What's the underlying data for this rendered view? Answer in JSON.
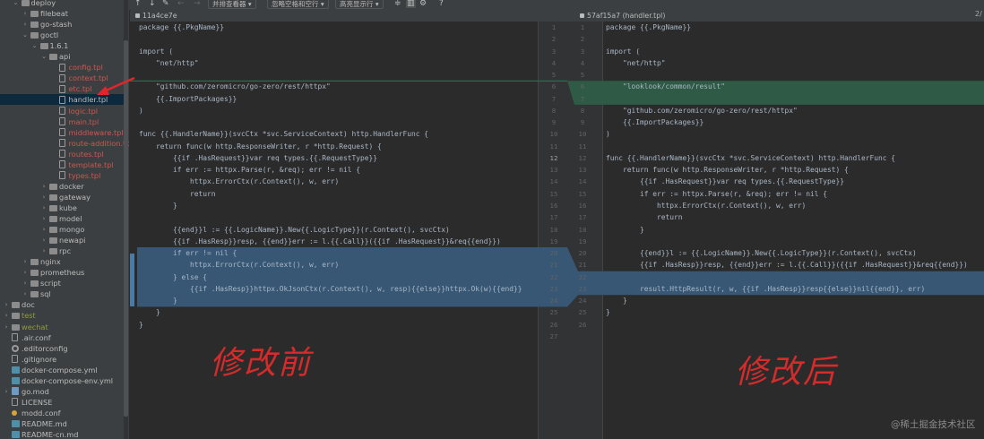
{
  "sidebar": {
    "items": [
      {
        "label": "deploy",
        "level": 1,
        "type": "folder",
        "open": true
      },
      {
        "label": "filebeat",
        "level": 2,
        "type": "folder",
        "open": false
      },
      {
        "label": "go-stash",
        "level": 2,
        "type": "folder",
        "open": false
      },
      {
        "label": "goctl",
        "level": 2,
        "type": "folder",
        "open": true
      },
      {
        "label": "1.6.1",
        "level": 3,
        "type": "folder",
        "open": true
      },
      {
        "label": "api",
        "level": 4,
        "type": "folder",
        "open": true
      },
      {
        "label": "config.tpl",
        "level": 5,
        "type": "file",
        "status": "red"
      },
      {
        "label": "context.tpl",
        "level": 5,
        "type": "file",
        "status": "red"
      },
      {
        "label": "etc.tpl",
        "level": 5,
        "type": "file",
        "status": "red"
      },
      {
        "label": "handler.tpl",
        "level": 5,
        "type": "file",
        "status": "selected"
      },
      {
        "label": "logic.tpl",
        "level": 5,
        "type": "file",
        "status": "red"
      },
      {
        "label": "main.tpl",
        "level": 5,
        "type": "file",
        "status": "red"
      },
      {
        "label": "middleware.tpl",
        "level": 5,
        "type": "file",
        "status": "red"
      },
      {
        "label": "route-addition.tpl",
        "level": 5,
        "type": "file",
        "status": "red"
      },
      {
        "label": "routes.tpl",
        "level": 5,
        "type": "file",
        "status": "red"
      },
      {
        "label": "template.tpl",
        "level": 5,
        "type": "file",
        "status": "red"
      },
      {
        "label": "types.tpl",
        "level": 5,
        "type": "file",
        "status": "red"
      },
      {
        "label": "docker",
        "level": 4,
        "type": "folder",
        "open": false
      },
      {
        "label": "gateway",
        "level": 4,
        "type": "folder",
        "open": false
      },
      {
        "label": "kube",
        "level": 4,
        "type": "folder",
        "open": false
      },
      {
        "label": "model",
        "level": 4,
        "type": "folder",
        "open": false
      },
      {
        "label": "mongo",
        "level": 4,
        "type": "folder",
        "open": false
      },
      {
        "label": "newapi",
        "level": 4,
        "type": "folder",
        "open": false
      },
      {
        "label": "rpc",
        "level": 4,
        "type": "folder",
        "open": false
      },
      {
        "label": "nginx",
        "level": 2,
        "type": "folder",
        "open": false
      },
      {
        "label": "prometheus",
        "level": 2,
        "type": "folder",
        "open": false
      },
      {
        "label": "script",
        "level": 2,
        "type": "folder",
        "open": false
      },
      {
        "label": "sql",
        "level": 2,
        "type": "folder",
        "open": false
      },
      {
        "label": "doc",
        "level": 0,
        "type": "folder",
        "open": false
      },
      {
        "label": "test",
        "level": 0,
        "type": "folder",
        "open": false,
        "status": "olive"
      },
      {
        "label": "wechat",
        "level": 0,
        "type": "folder",
        "open": false,
        "status": "olive"
      },
      {
        "label": ".air.conf",
        "level": 0,
        "type": "file"
      },
      {
        "label": ".editorconfig",
        "level": 0,
        "type": "cfg"
      },
      {
        "label": ".gitignore",
        "level": 0,
        "type": "file"
      },
      {
        "label": "docker-compose.yml",
        "level": 0,
        "type": "yml"
      },
      {
        "label": "docker-compose-env.yml",
        "level": 0,
        "type": "yml"
      },
      {
        "label": "go.mod",
        "level": 0,
        "type": "mod",
        "expandable": true
      },
      {
        "label": "LICENSE",
        "level": 0,
        "type": "file"
      },
      {
        "label": "modd.conf",
        "level": 0,
        "type": "modd"
      },
      {
        "label": "README.md",
        "level": 0,
        "type": "yml"
      },
      {
        "label": "README-cn.md",
        "level": 0,
        "type": "yml"
      }
    ]
  },
  "toolbar": {
    "icons": [
      "arrow-up-icon",
      "arrow-down-icon",
      "edit-icon",
      "back-icon",
      "forward-icon"
    ],
    "viewer": "并排查看器 ▾",
    "whitespace": "忽略空格和空行 ▾",
    "highlight": "高亮显示行 ▾",
    "diff_count": "2/"
  },
  "left": {
    "revision": "11a4ce7e",
    "lines": [
      "package {{.PkgName}}",
      "",
      "import (",
      "    \"net/http\"",
      "",
      "    \"github.com/zeromicro/go-zero/rest/httpx\"",
      "    {{.ImportPackages}}",
      ")",
      "",
      "func {{.HandlerName}}(svcCtx *svc.ServiceContext) http.HandlerFunc {",
      "    return func(w http.ResponseWriter, r *http.Request) {",
      "        {{if .HasRequest}}var req types.{{.RequestType}}",
      "        if err := httpx.Parse(r, &req); err != nil {",
      "            httpx.ErrorCtx(r.Context(), w, err)",
      "            return",
      "        }",
      "",
      "        {{end}}l := {{.LogicName}}.New{{.LogicType}}(r.Context(), svcCtx)",
      "        {{if .HasResp}}resp, {{end}}err := l.{{.Call}}({{if .HasRequest}}&req{{end}})",
      "        if err != nil {",
      "            httpx.ErrorCtx(r.Context(), w, err)",
      "        } else {",
      "            {{if .HasResp}}httpx.OkJsonCtx(r.Context(), w, resp){{else}}httpx.Ok(w){{end}}",
      "        }",
      "    }",
      "}"
    ]
  },
  "right": {
    "revision": "57af15a7 (handler.tpl)",
    "lines": [
      "package {{.PkgName}}",
      "",
      "import (",
      "    \"net/http\"",
      "",
      "    \"looklook/common/result\"",
      "",
      "    \"github.com/zeromicro/go-zero/rest/httpx\"",
      "    {{.ImportPackages}}",
      ")",
      "",
      "func {{.HandlerName}}(svcCtx *svc.ServiceContext) http.HandlerFunc {",
      "    return func(w http.ResponseWriter, r *http.Request) {",
      "        {{if .HasRequest}}var req types.{{.RequestType}}",
      "        if err := httpx.Parse(r, &req); err != nil {",
      "            httpx.ErrorCtx(r.Context(), w, err)",
      "            return",
      "        }",
      "",
      "        {{end}}l := {{.LogicName}}.New{{.LogicType}}(r.Context(), svcCtx)",
      "        {{if .HasResp}}resp, {{end}}err := l.{{.Call}}({{if .HasRequest}}&req{{end}})",
      "",
      "        result.HttpResult(r, w, {{if .HasResp}}resp{{else}}nil{{end}}, err)",
      "    }",
      "}",
      ""
    ]
  },
  "gutter": {
    "left_numbers": [
      "1",
      "2",
      "3",
      "4",
      "5",
      "6",
      "7",
      "8",
      "9",
      "10",
      "11",
      "12",
      "13",
      "14",
      "15",
      "16",
      "17",
      "18",
      "19",
      "20",
      "21",
      "22",
      "23",
      "24",
      "25",
      "26",
      "27"
    ],
    "right_numbers": [
      "1",
      "2",
      "3",
      "4",
      "5",
      "6",
      "7",
      "8",
      "9",
      "10",
      "11",
      "12",
      "13",
      "14",
      "15",
      "16",
      "17",
      "18",
      "19",
      "20",
      "21",
      "22",
      "23",
      "24",
      "25",
      "26"
    ],
    "current_line": 12
  },
  "annotations": {
    "before": "修改前",
    "after": "修改后"
  },
  "watermark": "@稀土掘金技术社区",
  "colors": {
    "added": "#2f5d47",
    "modified": "#385a78",
    "arrow": "#e0262a",
    "annot": "#d42b2b"
  }
}
